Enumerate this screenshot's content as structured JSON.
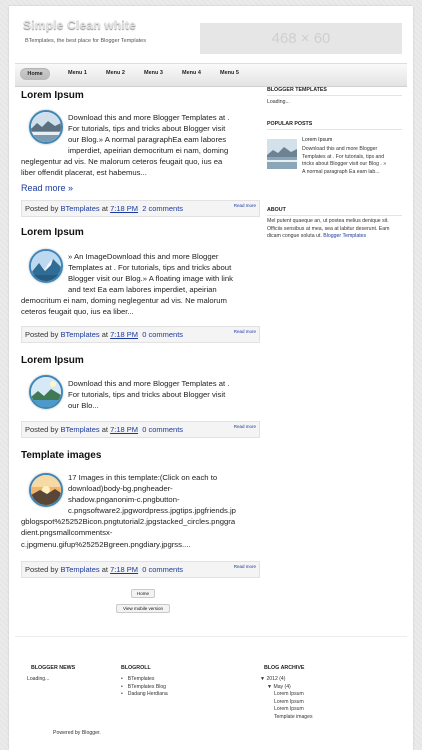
{
  "header": {
    "title": "Simple Clean white",
    "description": "BTemplates, the best place for Blogger Templates",
    "ad_placeholder": "468 × 60"
  },
  "nav": {
    "items": [
      {
        "label": "Home",
        "active": true
      },
      {
        "label": "Menu 1"
      },
      {
        "label": "Menu 2"
      },
      {
        "label": "Menu 3"
      },
      {
        "label": "Menu 4"
      },
      {
        "label": "Menu 5"
      }
    ]
  },
  "posts": [
    {
      "title": "Lorem Ipsum",
      "body_lines": [
        "Download this and more Blogger Templates at .",
        "For tutorials, tips and tricks about Blogger visit",
        "our Blog.» A normal paragraphEa eam labores",
        "imperdiet, apeirian democritum ei nam, doming",
        "neglegentur ad vis. Ne malorum ceteros feugait quo, ius ea",
        "liber offendit placerat, est habemus..."
      ],
      "read_more": "Read more »",
      "footer": {
        "posted_by": "Posted by",
        "author": "BTemplates",
        "at": "at",
        "time": "7:18 PM",
        "comments": "2 comments",
        "more": "Read more"
      }
    },
    {
      "title": "Lorem Ipsum",
      "body_lines": [
        "» An ImageDownload this and more Blogger",
        "Templates at . For tutorials, tips and tricks about",
        "Blogger visit our Blog.» A floating image with link",
        "and text Ea eam labores imperdiet, apeirian",
        "democritum ei nam, doming neglegentur ad vis. Ne malorum",
        "ceteros feugait quo, ius ea liber..."
      ],
      "footer": {
        "posted_by": "Posted by",
        "author": "BTemplates",
        "at": "at",
        "time": "7:18 PM",
        "comments": "0 comments",
        "more": "Read more"
      }
    },
    {
      "title": "Lorem Ipsum",
      "body_lines": [
        "Download this and more Blogger Templates at .",
        "For tutorials, tips and tricks about Blogger visit",
        "our Blo..."
      ],
      "footer": {
        "posted_by": "Posted by",
        "author": "BTemplates",
        "at": "at",
        "time": "7:18 PM",
        "comments": "0 comments",
        "more": "Read more"
      }
    },
    {
      "title": "Template images",
      "body_lines": [
        "17 Images in this template:(Click on each to",
        "download)body-bg.pngheader-",
        "shadow.pnganonim-c.pngbutton-",
        "c.pngsoftware2.jpgwordpress.jpgtips.jpgfriends.jp",
        "gblogspot%25252Bicon.pngtutorial2.jpgstacked_circles.pnggra",
        "dient.pngsmallcommentsx-",
        "c.jpgmenu.gifup%25252Bgreen.pngdiary.jpgrss...."
      ],
      "footer": {
        "posted_by": "Posted by",
        "author": "BTemplates",
        "at": "at",
        "time": "7:18 PM",
        "comments": "0 comments",
        "more": "Read more"
      }
    }
  ],
  "pager": {
    "home": "Home",
    "mobile": "View mobile version"
  },
  "sidebar": {
    "blogger_templates": {
      "title": "BLOGGER TEMPLATES",
      "text": "Loading..."
    },
    "popular_posts": {
      "title": "POPULAR POSTS",
      "post_title": "Lorem Ipsum",
      "snippet_lines": [
        "Download this and more Blogger",
        "Templates at . For tutorials, tips and",
        "tricks about Blogger visit our Blog . »",
        "A normal paragraph Ea eam lab..."
      ]
    },
    "about": {
      "title": "ABOUT",
      "lines": [
        "Mel putent quaeque an, ut postea melius denique sit.",
        "Officiis sensibus at mea, sea at labitur deserunt. Eam",
        "dicam congue soluta ut."
      ],
      "link": "Blogger Templates"
    }
  },
  "footer": {
    "blogger_news": {
      "title": "BLOGGER NEWS",
      "text": "Loading..."
    },
    "blogroll": {
      "title": "BLOGROLL",
      "items": [
        "BTemplates",
        "BTemplates Blog",
        "Dadang Herdiana"
      ]
    },
    "blog_archive": {
      "title": "BLOG ARCHIVE",
      "year": "2012 (4)",
      "month": "May (4)",
      "posts": [
        "Lorem Ipsum",
        "Lorem Ipsum",
        "Lorem Ipsum",
        "Template images"
      ]
    },
    "powered_by": "Powered by Blogger."
  },
  "colors": {
    "link": "#1b3a9e",
    "thumb_border": "#3e86b8",
    "background": "#ebebeb"
  }
}
